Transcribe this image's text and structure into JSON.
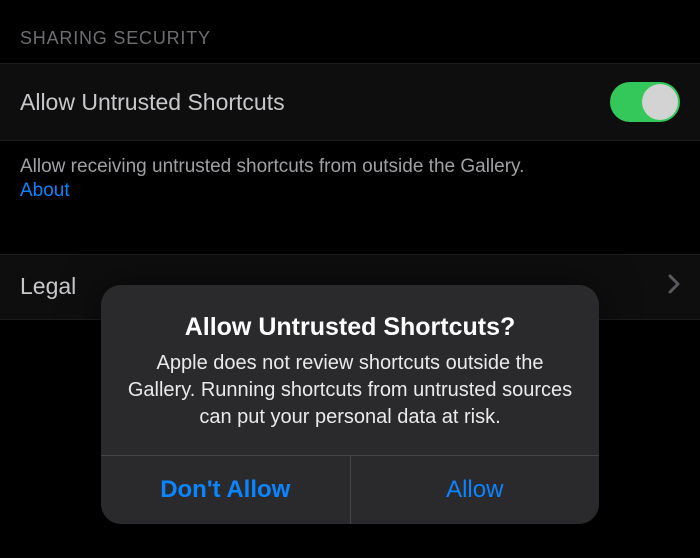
{
  "section": {
    "header": "Sharing Security"
  },
  "allowRow": {
    "title": "Allow Untrusted Shortcuts"
  },
  "footer": {
    "note": "Allow receiving untrusted shortcuts from outside the Gallery.",
    "aboutLink": "About"
  },
  "legalRow": {
    "title": "Legal"
  },
  "alert": {
    "title": "Allow Untrusted Shortcuts?",
    "message": "Apple does not review shortcuts outside the Gallery. Running shortcuts from untrusted sources can put your personal data at risk.",
    "dontAllow": "Don't Allow",
    "allow": "Allow"
  }
}
